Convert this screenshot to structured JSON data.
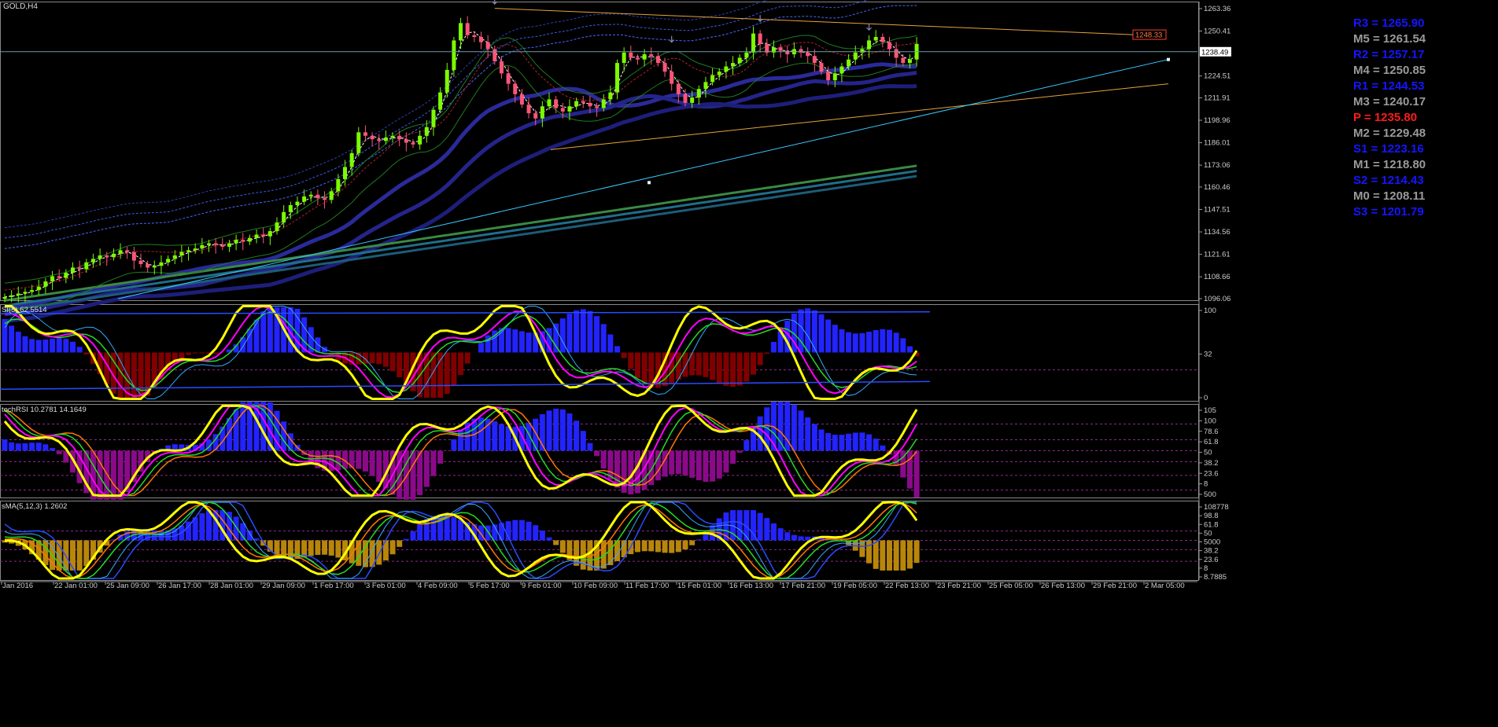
{
  "window": {
    "symbol_title": "GOLD,H4"
  },
  "colors": {
    "background": "#000000",
    "bull_candle": "#7CFC00",
    "bear_candle": "#FF5577",
    "axis_line": "#bbbbbb",
    "price_tag_bg": "#ffffff",
    "pivot_resistance": "#1515ff",
    "pivot_mid": "#9a9a9a",
    "pivot_p": "#ff1a1a",
    "trendline_orange": "#e6a23c",
    "trendline_cyan": "#38c8ff",
    "hist_pos": "#2323ff",
    "hist_neg_red": "#800000",
    "hist_neg_purple": "#8a0a8a",
    "osc_yellow": "#ffff00",
    "osc_magenta": "#ff00ff",
    "osc_green": "#22dd22",
    "osc_orange": "#ff7700",
    "osc_blue": "#2a4cff",
    "osc_light_blue": "#33aaff"
  },
  "price_axis": {
    "ticks": [
      "1263.36",
      "1250.41",
      "1224.51",
      "1211.91",
      "1198.96",
      "1186.01",
      "1173.06",
      "1160.46",
      "1147.51",
      "1134.56",
      "1121.61",
      "1108.66",
      "1096.06"
    ],
    "current_price": "1238.49",
    "alert_price": "1248.33"
  },
  "pivots": [
    {
      "label": "R3 = 1265.90",
      "kind": "resistance"
    },
    {
      "label": "M5 = 1261.54",
      "kind": "mid"
    },
    {
      "label": "R2 = 1257.17",
      "kind": "resistance"
    },
    {
      "label": "M4 = 1250.85",
      "kind": "mid"
    },
    {
      "label": "R1 = 1244.53",
      "kind": "resistance"
    },
    {
      "label": "M3 = 1240.17",
      "kind": "mid"
    },
    {
      "label": "P   = 1235.80",
      "kind": "pivot"
    },
    {
      "label": "M2 = 1229.48",
      "kind": "mid"
    },
    {
      "label": "S1 = 1223.16",
      "kind": "resistance"
    },
    {
      "label": "M1 = 1218.80",
      "kind": "mid"
    },
    {
      "label": "S2 = 1214.43",
      "kind": "resistance"
    },
    {
      "label": "M0 = 1208.11",
      "kind": "mid"
    },
    {
      "label": "S3 = 1201.79",
      "kind": "resistance"
    }
  ],
  "subwindows": [
    {
      "title": "SI(5) 62.5514",
      "ticks": [
        "100",
        "32",
        "0"
      ]
    },
    {
      "title": "tochRSI 10.2781 14.1649",
      "ticks": [
        "105",
        "100",
        "78.6",
        "61.8",
        "50",
        "38.2",
        "23.6",
        "8",
        "500"
      ]
    },
    {
      "title": "sMA(5,12,3) 1.2602",
      "ticks": [
        "108778",
        "98.8",
        "61.8",
        "50",
        "5000",
        "38.2",
        "23.6",
        "8",
        "8.7885"
      ]
    }
  ],
  "time_axis": [
    "Jan 2016",
    "22 Jan 01:00",
    "25 Jan 09:00",
    "26 Jan 17:00",
    "28 Jan 01:00",
    "29 Jan 09:00",
    "1 Feb 17:00",
    "3 Feb 01:00",
    "4 Feb 09:00",
    "5 Feb 17:00",
    "9 Feb 01:00",
    "10 Feb 09:00",
    "11 Feb 17:00",
    "15 Feb 01:00",
    "16 Feb 13:00",
    "17 Feb 21:00",
    "19 Feb 05:00",
    "22 Feb 13:00",
    "23 Feb 21:00",
    "25 Feb 05:00",
    "26 Feb 13:00",
    "29 Feb 21:00",
    "2 Mar 05:00"
  ],
  "chart_data": [
    {
      "type": "candlestick",
      "title": "GOLD,H4",
      "ylim": [
        1096.06,
        1266.5
      ],
      "closes": [
        1097,
        1098,
        1099,
        1100,
        1101,
        1103,
        1106,
        1109,
        1108,
        1111,
        1114,
        1113,
        1117,
        1119,
        1121,
        1120,
        1122,
        1124,
        1123,
        1118,
        1116,
        1114,
        1115,
        1117,
        1119,
        1121,
        1123,
        1124,
        1125,
        1127,
        1128,
        1127,
        1126,
        1128,
        1130,
        1129,
        1131,
        1133,
        1132,
        1135,
        1140,
        1146,
        1150,
        1152,
        1155,
        1156,
        1154,
        1153,
        1158,
        1165,
        1172,
        1180,
        1192,
        1190,
        1188,
        1187,
        1189,
        1190,
        1188,
        1186,
        1185,
        1190,
        1195,
        1205,
        1215,
        1228,
        1245,
        1255,
        1248,
        1247,
        1244,
        1240,
        1233,
        1226,
        1220,
        1214,
        1208,
        1203,
        1200,
        1207,
        1211,
        1206,
        1204,
        1207,
        1210,
        1209,
        1207,
        1206,
        1211,
        1215,
        1232,
        1238,
        1235,
        1234,
        1237,
        1236,
        1232,
        1227,
        1220,
        1214,
        1209,
        1212,
        1217,
        1221,
        1225,
        1227,
        1230,
        1232,
        1235,
        1238,
        1249,
        1243,
        1238,
        1241,
        1239,
        1237,
        1240,
        1238,
        1236,
        1232,
        1227,
        1222,
        1226,
        1230,
        1234,
        1238,
        1240,
        1245,
        1247,
        1244,
        1240,
        1235,
        1232,
        1234,
        1243
      ],
      "ma_series": 5
    },
    {
      "type": "line",
      "title": "SI(5) 62.5514",
      "ylim": [
        0,
        100
      ],
      "series_len": 135
    },
    {
      "type": "line",
      "title": "tochRSI 10.2781 14.1649",
      "ylim": [
        0,
        105
      ]
    },
    {
      "type": "line",
      "title": "sMA(5,12,3) 1.2602",
      "ylim": [
        0,
        108.8
      ]
    }
  ]
}
